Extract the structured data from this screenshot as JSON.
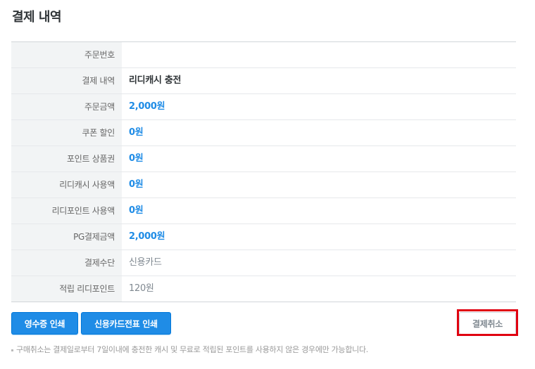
{
  "page": {
    "title": "결제 내역"
  },
  "rows": [
    {
      "label": "주문번호",
      "value": ""
    },
    {
      "label": "결제 내역",
      "value": "리디캐시 충전"
    },
    {
      "label": "주문금액",
      "value": "2,000원"
    },
    {
      "label": "쿠폰 할인",
      "value": "0원"
    },
    {
      "label": "포인트 상품권",
      "value": "0원"
    },
    {
      "label": "리디캐시 사용액",
      "value": "0원"
    },
    {
      "label": "리디포인트 사용액",
      "value": "0원"
    },
    {
      "label": "PG결제금액",
      "value": "2,000원"
    },
    {
      "label": "결제수단",
      "value": "신용카드"
    },
    {
      "label": "적립 리디포인트",
      "value": "120원"
    }
  ],
  "buttons": {
    "receipt": "영수증 인쇄",
    "card_slip": "신용카드전표 인쇄",
    "cancel": "결제취소"
  },
  "notice": "구매취소는 결제일로부터 7일이내에 충전한 캐시 및 무료로 적립된 포인트를 사용하지 않은 경우에만 가능합니다.",
  "colors": {
    "accent_blue": "#1f8ce6",
    "highlight_red": "#e00010"
  }
}
